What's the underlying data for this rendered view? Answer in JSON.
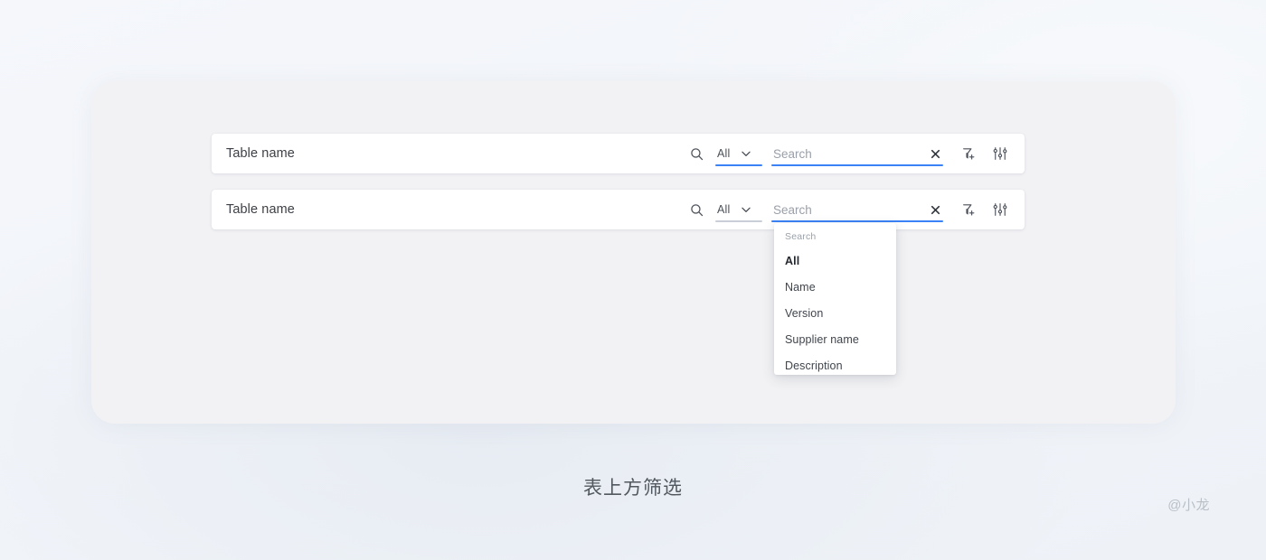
{
  "canvas": {
    "background_color": "#f2f5f9",
    "card_color": "#f2f2f4",
    "accent_color": "#3b82f6"
  },
  "caption": "表上方筛选",
  "watermark": "@小龙",
  "rows": [
    {
      "table_name": "Table name",
      "search_icon": "search-icon",
      "scope": {
        "value": "All",
        "chevron_icon": "chevron-down-icon",
        "underline_color": "#3b82f6"
      },
      "search": {
        "value": "",
        "placeholder": "Search",
        "clear_icon": "close-icon",
        "underline_color": "#3b82f6"
      },
      "tools": [
        {
          "name": "filter-add-icon",
          "label": "Add filter"
        },
        {
          "name": "tune-sliders-icon",
          "label": "Settings"
        }
      ],
      "dropdown_open": false
    },
    {
      "table_name": "Table name",
      "search_icon": "search-icon",
      "scope": {
        "value": "All",
        "chevron_icon": "chevron-down-icon",
        "underline_color": "#c9ced7"
      },
      "search": {
        "value": "",
        "placeholder": "Search",
        "clear_icon": "close-icon",
        "underline_color": "#3b82f6"
      },
      "tools": [
        {
          "name": "filter-add-icon",
          "label": "Add filter"
        },
        {
          "name": "tune-sliders-icon",
          "label": "Settings"
        }
      ],
      "dropdown_open": true
    }
  ],
  "dropdown": {
    "caption": "Search",
    "selected": "All",
    "items": [
      {
        "label": "All",
        "selected": true
      },
      {
        "label": "Name",
        "selected": false
      },
      {
        "label": "Version",
        "selected": false
      },
      {
        "label": "Supplier name",
        "selected": false
      },
      {
        "label": "Description",
        "selected": false
      }
    ]
  }
}
